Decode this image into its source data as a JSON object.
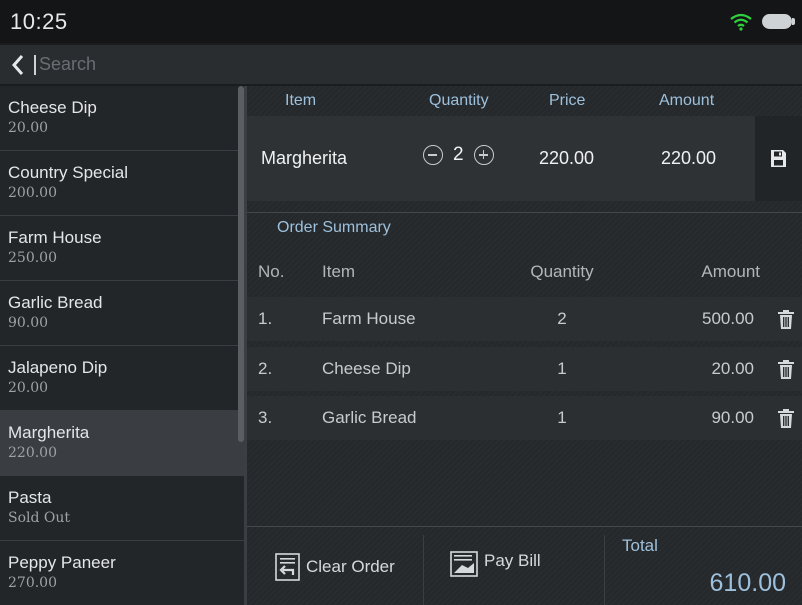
{
  "status": {
    "time": "10:25",
    "wifi_icon": "wifi-icon",
    "battery_icon": "battery-icon",
    "wifi_color": "#2fd23c"
  },
  "search": {
    "placeholder": "Search",
    "back_icon": "chevron-left-icon"
  },
  "menu": [
    {
      "name": "Cheese Dip",
      "price": "20.00"
    },
    {
      "name": "Country Special",
      "price": "200.00"
    },
    {
      "name": "Farm House",
      "price": "250.00"
    },
    {
      "name": "Garlic Bread",
      "price": "90.00"
    },
    {
      "name": "Jalapeno Dip",
      "price": "20.00"
    },
    {
      "name": "Margherita",
      "price": "220.00",
      "selected": true
    },
    {
      "name": "Pasta",
      "price": "Sold Out"
    },
    {
      "name": "Peppy Paneer",
      "price": "270.00"
    }
  ],
  "item_editor": {
    "headers": {
      "item": "Item",
      "quantity": "Quantity",
      "price": "Price",
      "amount": "Amount"
    },
    "row": {
      "name": "Margherita",
      "quantity": "2",
      "price": "220.00",
      "amount": "220.00"
    },
    "save_icon": "save-icon"
  },
  "summary": {
    "title": "Order Summary",
    "headers": {
      "no": "No.",
      "item": "Item",
      "quantity": "Quantity",
      "amount": "Amount"
    },
    "rows": [
      {
        "no": "1.",
        "item": "Farm House",
        "quantity": "2",
        "amount": "500.00"
      },
      {
        "no": "2.",
        "item": "Cheese Dip",
        "quantity": "1",
        "amount": "20.00"
      },
      {
        "no": "3.",
        "item": "Garlic Bread",
        "quantity": "1",
        "amount": "90.00"
      }
    ]
  },
  "footer": {
    "clear_label": "Clear Order",
    "pay_label": "Pay Bill",
    "total_label": "Total",
    "total_value": "610.00"
  },
  "colors": {
    "accent": "#9dc0dc",
    "background": "#1a1c1e"
  }
}
